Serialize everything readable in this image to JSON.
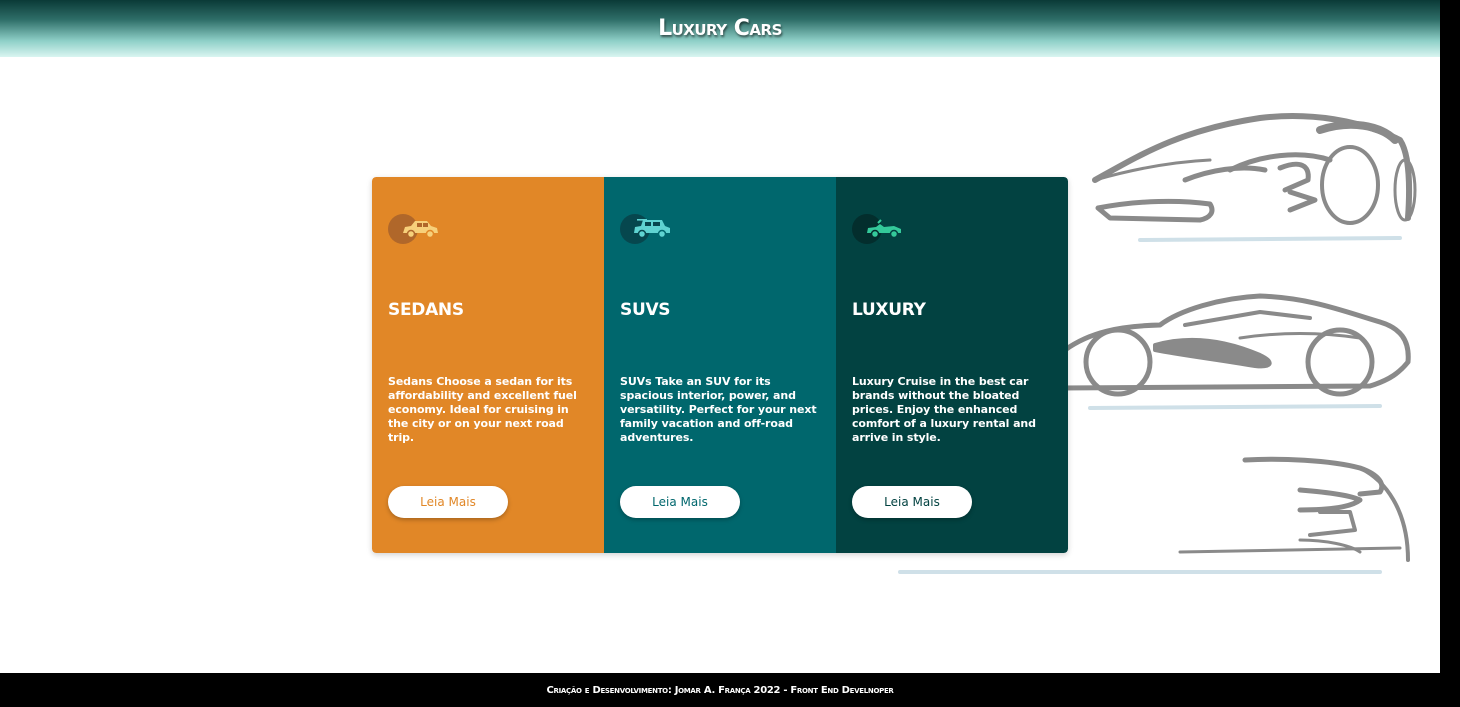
{
  "header": {
    "title": "Luxury Cars"
  },
  "theme": {
    "header_gradient": [
      "#0a3a37",
      "#2f6f69",
      "#8fd0c8",
      "#d9f5f1"
    ],
    "footer_bg": "#000000"
  },
  "cards": [
    {
      "id": "sedans",
      "icon": "sedan-car-icon",
      "title": "SEDANS",
      "text": "Sedans Choose a sedan for its affordability and excellent fuel economy. Ideal for cruising in the city or on your next road trip.",
      "button_label": "Leia Mais",
      "bg_color": "#e18727",
      "icon_color": "#f7d07a"
    },
    {
      "id": "suvs",
      "icon": "suv-car-icon",
      "title": "SUVS",
      "text": "SUVs Take an SUV for its spacious interior, power, and versatility. Perfect for your next family vacation and off-road adventures.",
      "button_label": "Leia Mais",
      "bg_color": "#00676d",
      "icon_color": "#5fd3d1"
    },
    {
      "id": "luxury",
      "icon": "convertible-car-icon",
      "title": "LUXURY",
      "text": "Luxury Cruise in the best car brands without the bloated prices. Enjoy the enhanced comfort of a luxury rental and arrive in style.",
      "button_label": "Leia Mais",
      "bg_color": "#024241",
      "icon_color": "#34c99a"
    }
  ],
  "background_art": {
    "icon": "sports-car-sketch-icon",
    "color": "#8a8a8a"
  },
  "footer": {
    "text": "Criação e Desenvolvimento: Jomar A. França 2022 - Front End Develnoper"
  }
}
